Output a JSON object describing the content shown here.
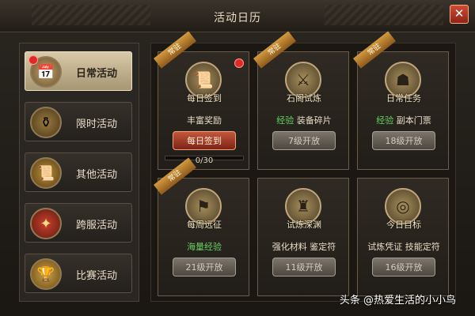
{
  "window": {
    "title": "活动日历",
    "close_label": "✕"
  },
  "sidebar": {
    "items": [
      {
        "label": "日常活动",
        "icon": "calendar-icon",
        "glyph": "📅",
        "active": true
      },
      {
        "label": "限时活动",
        "icon": "treasure-bowl-icon",
        "glyph": "⚱"
      },
      {
        "label": "其他活动",
        "icon": "scroll-icon",
        "glyph": "📜"
      },
      {
        "label": "跨服活动",
        "icon": "emblem-icon",
        "glyph": "✦"
      },
      {
        "label": "比赛活动",
        "icon": "trophy-icon",
        "glyph": "🏆"
      }
    ]
  },
  "cards": [
    {
      "name": "每日签到",
      "ribbon": "常驻",
      "reward_prefix": "",
      "reward_text": "丰富奖励",
      "button": "每日签到",
      "button_state": "active",
      "progress_text": "0/30",
      "has_red_dot": true,
      "icon": "scroll-icon",
      "glyph": "📜"
    },
    {
      "name": "石阁试炼",
      "ribbon": "常驻",
      "reward_prefix": "经验",
      "reward_text": "装备碎片",
      "button": "7级开放",
      "button_state": "locked",
      "icon": "chest-icon",
      "glyph": "⚔"
    },
    {
      "name": "日常任务",
      "ribbon": "常驻",
      "reward_prefix": "经验",
      "reward_text": "副本门票",
      "button": "18级开放",
      "button_state": "locked",
      "icon": "task-icon",
      "glyph": "☗"
    },
    {
      "name": "每周远征",
      "ribbon": "常驻",
      "reward_prefix": "",
      "reward_text": "海量经验",
      "reward_green": true,
      "button": "21级开放",
      "button_state": "locked",
      "icon": "expedition-icon",
      "glyph": "⚑"
    },
    {
      "name": "试炼深渊",
      "ribbon": "",
      "reward_prefix": "",
      "reward_text": "强化材料 鉴定符",
      "button": "11级开放",
      "button_state": "locked",
      "icon": "abyss-icon",
      "glyph": "♜"
    },
    {
      "name": "今日目标",
      "ribbon": "",
      "reward_prefix": "",
      "reward_text": "试炼凭证 技能定符",
      "button": "16级开放",
      "button_state": "locked",
      "icon": "goal-icon",
      "glyph": "◎"
    }
  ],
  "watermark": "头条 @热爱生活的小小鸟"
}
